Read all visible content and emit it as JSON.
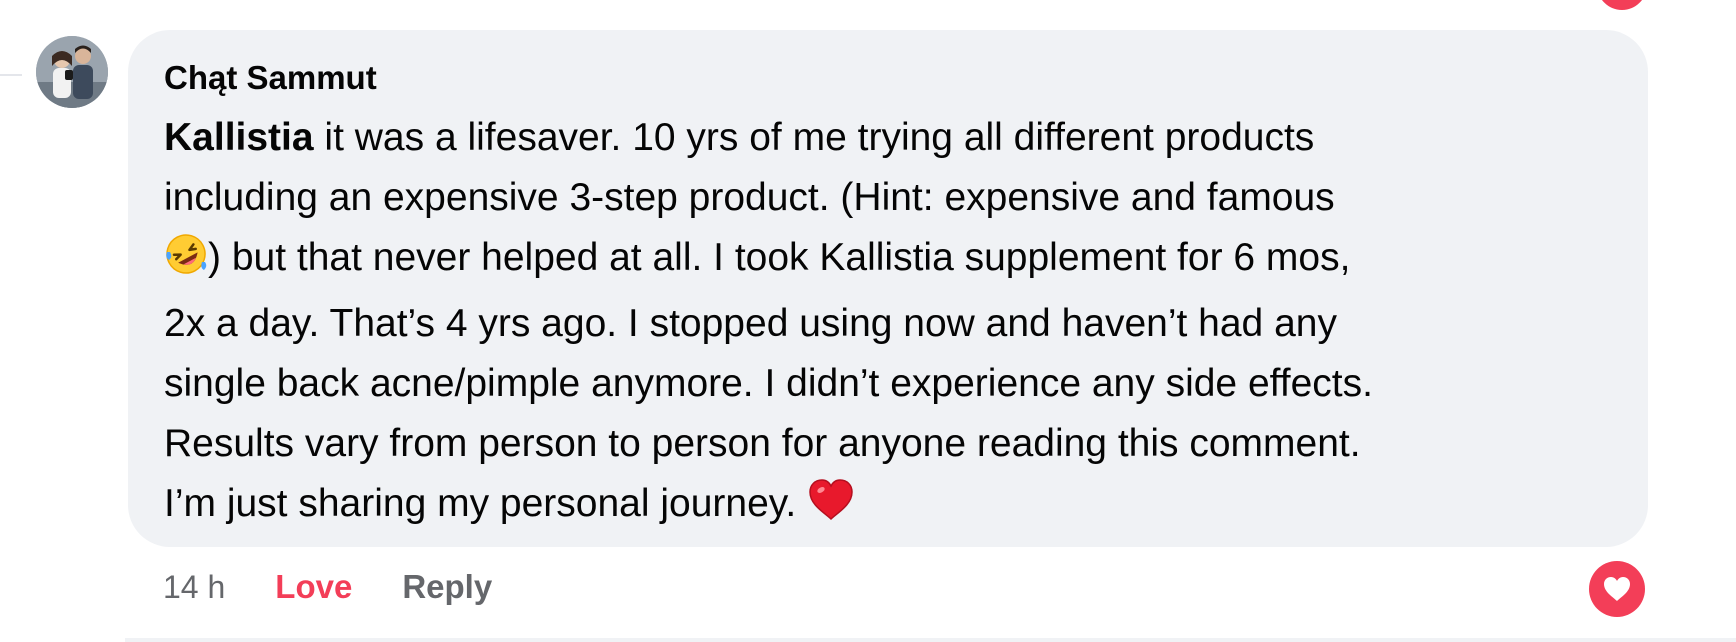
{
  "comment": {
    "author": "Chąt Sammut",
    "avatar_icon": "user-avatar-photo",
    "mention": "Kallistia",
    "text_part1": " it was a lifesaver. 10 yrs of me trying all different products\nincluding an expensive 3-step product. (Hint: expensive and famous\n",
    "emoji_laughing": "rolling-on-floor-laughing-emoji",
    "text_part2": ") but that never helped at all. I took Kallistia supplement for 6 mos,\n2x a day. That’s 4 yrs ago. I stopped using now and haven’t had any\nsingle back acne/pimple anymore. I didn’t experience any side effects.\nResults vary from person to person for anyone reading this comment.\nI’m just sharing my personal journey. ",
    "emoji_heart": "red-heart-emoji"
  },
  "actions": {
    "timestamp": "14 h",
    "love_label": "Love",
    "reply_label": "Reply"
  },
  "reaction": {
    "icon": "heart-reaction-icon",
    "color": "#f33e58"
  },
  "colors": {
    "bubble": "#f0f2f5",
    "text": "#050505",
    "muted": "#65676b",
    "love": "#f33e58"
  }
}
